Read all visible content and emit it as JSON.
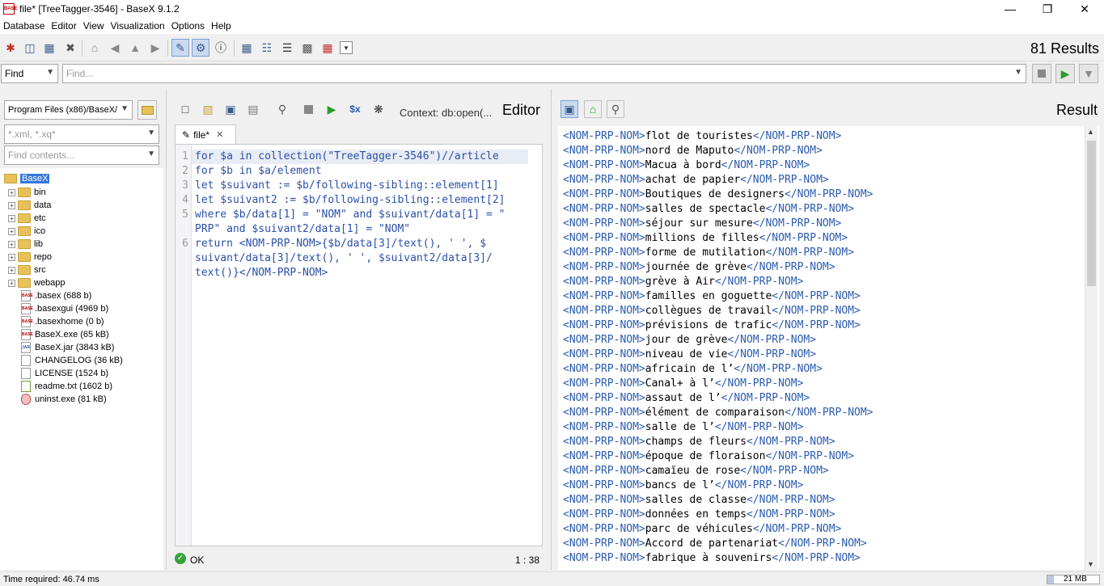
{
  "window": {
    "title": "file* [TreeTagger-3546] - BaseX 9.1.2",
    "icon": "basex-app-icon"
  },
  "menu": [
    "Database",
    "Editor",
    "View",
    "Visualization",
    "Options",
    "Help"
  ],
  "toolbar": {
    "results_count": "81 Results"
  },
  "find": {
    "mode": "Find",
    "placeholder": "Find..."
  },
  "project": {
    "path": "Program Files (x86)/BaseX/",
    "filter_placeholder": "*.xml, *.xq*",
    "contents_placeholder": "Find contents...",
    "root": "BaseX",
    "folders": [
      "bin",
      "data",
      "etc",
      "ico",
      "lib",
      "repo",
      "src",
      "webapp"
    ],
    "files": [
      {
        "name": ".basex (688 b)",
        "icon": "basex-file-icon"
      },
      {
        "name": ".basexgui (4969 b)",
        "icon": "basex-file-icon"
      },
      {
        "name": ".basexhome (0 b)",
        "icon": "basex-file-icon"
      },
      {
        "name": "BaseX.exe (65 kB)",
        "icon": "basex-file-icon"
      },
      {
        "name": "BaseX.jar (3843 kB)",
        "icon": "jar-file-icon"
      },
      {
        "name": "CHANGELOG (36 kB)",
        "icon": "text-file-icon"
      },
      {
        "name": "LICENSE (1524 b)",
        "icon": "text-file-icon"
      },
      {
        "name": "readme.txt (1602 b)",
        "icon": "text-file-icon"
      },
      {
        "name": "uninst.exe (81 kB)",
        "icon": "exe-file-icon"
      }
    ]
  },
  "editor": {
    "context": "Context: db:open(...",
    "label": "Editor",
    "tab": "file*",
    "status": "OK",
    "cursor": "1 : 38",
    "lines": [
      {
        "num": "1",
        "text": "for $a in collection(\"TreeTagger-3546\")//article"
      },
      {
        "num": "",
        "text": "for $b in $a/element"
      },
      {
        "num": "",
        "text": "let $suivant := $b/following-sibling::element[1]"
      },
      {
        "num": "",
        "text": "let $suivant2 := $b/following-sibling::element[2]"
      },
      {
        "num": "5",
        "text": "where $b/data[1] = \"NOM\" and $suivant/data[1] = \""
      },
      {
        "num": "",
        "text": "PRP\" and $suivant2/data[1] = \"NOM\""
      },
      {
        "num": "6",
        "text": "return <NOM-PRP-NOM>{$b/data[3]/text(), ' ', $"
      },
      {
        "num": "",
        "text": "suivant/data[3]/text(), ' ', $suivant2/data[3]/"
      },
      {
        "num": "",
        "text": "text()}</NOM-PRP-NOM>"
      }
    ],
    "line_numbers_shown": [
      "1",
      "2",
      "3",
      "4",
      "5",
      "",
      "6",
      "",
      ""
    ]
  },
  "result": {
    "label": "Result",
    "open_tag": "<NOM-PRP-NOM>",
    "close_tag": "</NOM-PRP-NOM>",
    "items": [
      "flot de touristes",
      "nord de Maputo",
      "Macua à bord",
      "achat de papier",
      "Boutiques de designers",
      "salles de spectacle",
      "séjour sur mesure",
      "millions de filles",
      "forme de mutilation",
      "journée de grève",
      "grève à Air",
      "familles en goguette",
      "collègues de travail",
      "prévisions de trafic",
      "jour de grève",
      "niveau de vie",
      "africain de l’",
      "Canal+ à l’",
      "assaut de l’",
      "élément de comparaison",
      "salle de l’",
      "champs de fleurs",
      "époque de floraison",
      "camaïeu de rose",
      "bancs de l’",
      "salles de classe",
      "données en temps",
      "parc de véhicules",
      "Accord de partenariat",
      "fabrique à souvenirs"
    ]
  },
  "statusbar": {
    "time": "Time required: 46.74 ms",
    "memory": "21 MB"
  }
}
